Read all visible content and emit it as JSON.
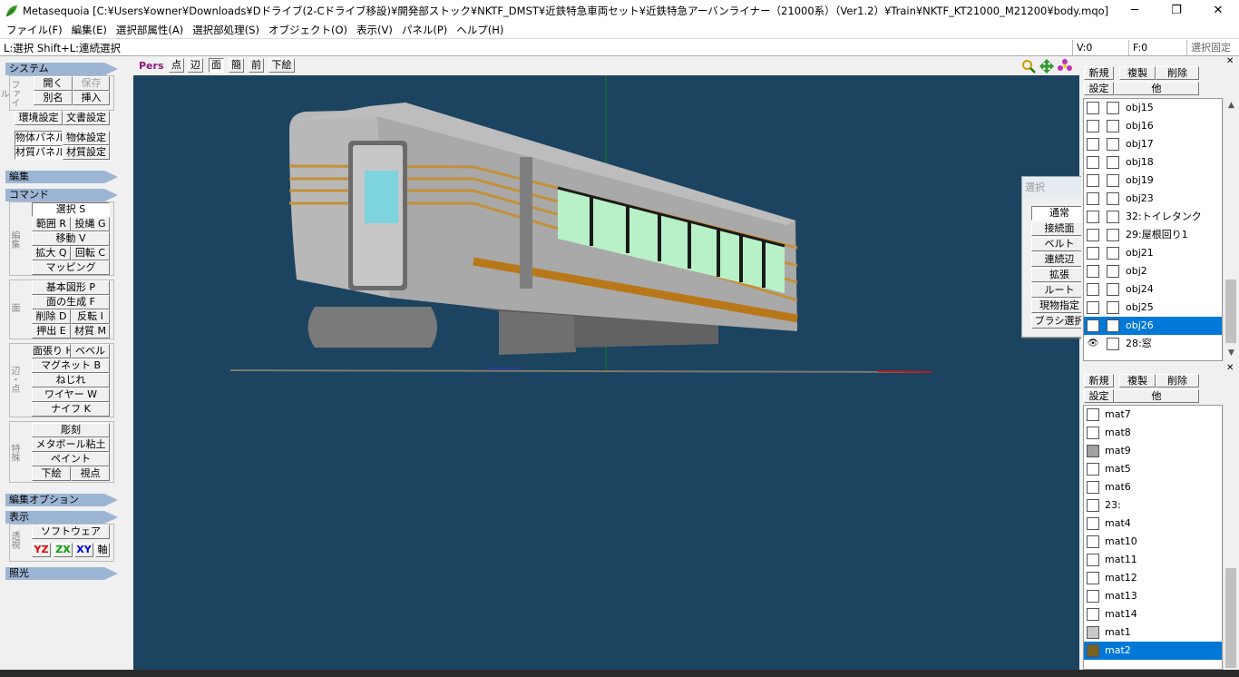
{
  "window": {
    "title": "Metasequoia [C:¥Users¥owner¥Downloads¥Dドライブ(2-Cドライブ移設)¥開発部ストック¥NKTF_DMST¥近鉄特急車両セット¥近鉄特急アーバンライナー（21000系）（Ver1.2）¥Train¥NKTF_KT21000_M21200¥body.mqo]",
    "min": "─",
    "max": "❐",
    "close": "✕"
  },
  "menu": [
    "ファイル(F)",
    "編集(E)",
    "選択部属性(A)",
    "選択部処理(S)",
    "オブジェクト(O)",
    "表示(V)",
    "パネル(P)",
    "ヘルプ(H)"
  ],
  "status": {
    "hint": "L:選択  Shift+L:連続選択",
    "v": "V:0",
    "f": "F:0",
    "lock": "選択固定"
  },
  "left": {
    "system": {
      "header": "システム",
      "vlabel": "ファイル",
      "open": "開く",
      "save": "保存",
      "saveas": "別名",
      "insert": "挿入",
      "env": "環境設定",
      "docset": "文書設定",
      "objpanel": "物体パネル",
      "objset": "物体設定",
      "matpanel": "材質パネル",
      "matset": "材質設定"
    },
    "edit_header": "編集",
    "command": {
      "header": "コマンド",
      "vlabel_edit": "編集",
      "select": "選択 S",
      "range": "範囲 R",
      "lasso": "投縄 G",
      "move": "移動 V",
      "scale": "拡大 Q",
      "rotate": "回転 C",
      "mapping": "マッピング",
      "vlabel_face": "面",
      "primitive": "基本図形 P",
      "facegen": "面の生成 F",
      "delete": "削除 D",
      "flip": "反転 I",
      "extrude": "押出 E",
      "material": "材質 M",
      "vlabel_edge": "辺・点",
      "stretch": "面張り H",
      "bevel": "ベベル",
      "magnet": "マグネット B",
      "twist": "ねじれ",
      "wire": "ワイヤー W",
      "knife": "ナイフ K",
      "vlabel_special": "特殊",
      "sculpt": "彫刻",
      "metaball": "メタボール粘土",
      "paint": "ペイント",
      "underlay": "下絵",
      "viewpoint": "視点"
    },
    "editopt_header": "編集オプション",
    "display": {
      "header": "表示",
      "vlabel": "透視",
      "software": "ソフトウェア",
      "yz": "YZ",
      "zx": "ZX",
      "xy": "XY",
      "axis": "軸"
    },
    "light_header": "照光"
  },
  "viewtoolbar": {
    "pers": "Pers",
    "point": "点",
    "edge": "辺",
    "face": "面",
    "simple": "簡",
    "front": "前",
    "underlay": "下絵"
  },
  "select_panel": {
    "title": "選択",
    "items": [
      "通常",
      "接続面",
      "ベルト",
      "連続辺",
      "拡張",
      "ルート",
      "現物指定",
      "ブラシ選択"
    ]
  },
  "objects": {
    "buttons": {
      "new": "新規",
      "dup": "複製",
      "del": "削除",
      "settings": "設定",
      "other": "他"
    },
    "items": [
      {
        "name": "obj15",
        "eye": false,
        "selected": false
      },
      {
        "name": "obj16",
        "eye": false,
        "selected": false
      },
      {
        "name": "obj17",
        "eye": false,
        "selected": false
      },
      {
        "name": "obj18",
        "eye": false,
        "selected": false
      },
      {
        "name": "obj19",
        "eye": false,
        "selected": false
      },
      {
        "name": "obj23",
        "eye": false,
        "selected": false
      },
      {
        "name": "32:トイレタンク",
        "eye": false,
        "selected": false
      },
      {
        "name": "29:屋根回り1",
        "eye": false,
        "selected": false
      },
      {
        "name": "obj21",
        "eye": false,
        "selected": false
      },
      {
        "name": "obj2",
        "eye": false,
        "selected": false
      },
      {
        "name": "obj24",
        "eye": false,
        "selected": false
      },
      {
        "name": "obj25",
        "eye": false,
        "selected": false
      },
      {
        "name": "obj26",
        "eye": false,
        "selected": true
      },
      {
        "name": "28:窓",
        "eye": true,
        "selected": false
      }
    ]
  },
  "materials": {
    "buttons": {
      "new": "新規",
      "dup": "複製",
      "del": "削除",
      "settings": "設定",
      "other": "他"
    },
    "items": [
      {
        "name": "mat7",
        "color": "#ffffff",
        "selected": false
      },
      {
        "name": "mat8",
        "color": "#ffffff",
        "selected": false
      },
      {
        "name": "mat9",
        "color": "#a0a0a0",
        "selected": false
      },
      {
        "name": "mat5",
        "color": "#ffffff",
        "selected": false
      },
      {
        "name": "mat6",
        "color": "#ffffff",
        "selected": false
      },
      {
        "name": "23:",
        "color": "#ffffff",
        "selected": false
      },
      {
        "name": "mat4",
        "color": "#ffffff",
        "selected": false
      },
      {
        "name": "mat10",
        "color": "#ffffff",
        "selected": false
      },
      {
        "name": "mat11",
        "color": "#ffffff",
        "selected": false
      },
      {
        "name": "mat12",
        "color": "#ffffff",
        "selected": false
      },
      {
        "name": "mat13",
        "color": "#ffffff",
        "selected": false
      },
      {
        "name": "mat14",
        "color": "#ffffff",
        "selected": false
      },
      {
        "name": "mat1",
        "color": "#c8c8c8",
        "selected": false
      },
      {
        "name": "mat2",
        "color": "#7a6220",
        "selected": true
      }
    ]
  },
  "viewport": {
    "background": "#1c4360",
    "selection_color": "#0078d7"
  }
}
